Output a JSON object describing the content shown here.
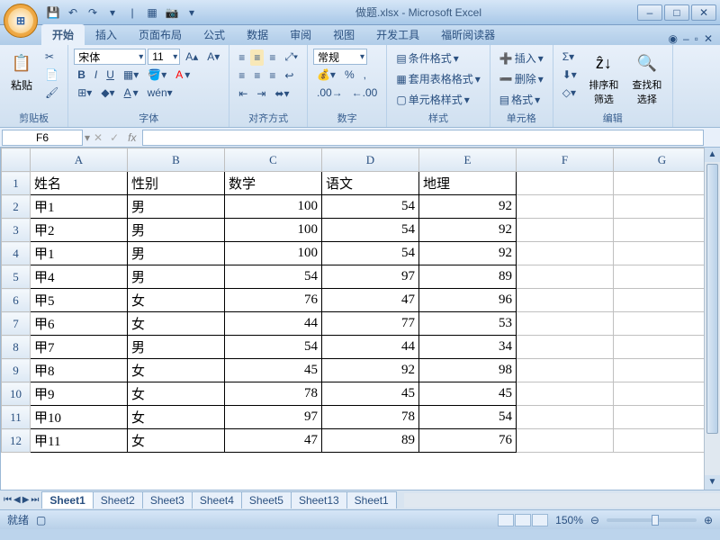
{
  "title": "做题.xlsx - Microsoft Excel",
  "qat": {
    "save": "💾",
    "undo": "↶",
    "redo": "↷"
  },
  "tabs": [
    "开始",
    "插入",
    "页面布局",
    "公式",
    "数据",
    "审阅",
    "视图",
    "开发工具",
    "福昕阅读器"
  ],
  "active_tab": 0,
  "ribbon": {
    "clipboard": {
      "label": "剪贴板",
      "paste": "粘贴",
      "cut": "✂",
      "copy": "📄",
      "brush": "🖌"
    },
    "font": {
      "label": "字体",
      "name": "宋体",
      "size": "11",
      "bold": "B",
      "italic": "I",
      "underline": "U"
    },
    "align": {
      "label": "对齐方式"
    },
    "number": {
      "label": "数字",
      "format": "常规",
      "percent": "%",
      "comma": ","
    },
    "styles": {
      "label": "样式",
      "cond": "条件格式",
      "table": "套用表格格式",
      "cell": "单元格样式"
    },
    "cells": {
      "label": "单元格",
      "insert": "插入",
      "delete": "删除",
      "format": "格式"
    },
    "editing": {
      "label": "编辑",
      "sort": "排序和筛选",
      "find": "查找和选择"
    }
  },
  "namebox": "F6",
  "formula": "",
  "columns": [
    "A",
    "B",
    "C",
    "D",
    "E",
    "F",
    "G"
  ],
  "headers": [
    "姓名",
    "性别",
    "数学",
    "语文",
    "地理"
  ],
  "rows": [
    {
      "n": 1
    },
    {
      "n": 2,
      "d": [
        "甲1",
        "男",
        "100",
        "54",
        "92"
      ]
    },
    {
      "n": 3,
      "d": [
        "甲2",
        "男",
        "100",
        "54",
        "92"
      ]
    },
    {
      "n": 4,
      "d": [
        "甲1",
        "男",
        "100",
        "54",
        "92"
      ]
    },
    {
      "n": 5,
      "d": [
        "甲4",
        "男",
        "54",
        "97",
        "89"
      ]
    },
    {
      "n": 6,
      "d": [
        "甲5",
        "女",
        "76",
        "47",
        "96"
      ]
    },
    {
      "n": 7,
      "d": [
        "甲6",
        "女",
        "44",
        "77",
        "53"
      ]
    },
    {
      "n": 8,
      "d": [
        "甲7",
        "男",
        "54",
        "44",
        "34"
      ]
    },
    {
      "n": 9,
      "d": [
        "甲8",
        "女",
        "45",
        "92",
        "98"
      ]
    },
    {
      "n": 10,
      "d": [
        "甲9",
        "女",
        "78",
        "45",
        "45"
      ]
    },
    {
      "n": 11,
      "d": [
        "甲10",
        "女",
        "97",
        "78",
        "54"
      ]
    },
    {
      "n": 12,
      "d": [
        "甲11",
        "女",
        "47",
        "89",
        "76"
      ]
    }
  ],
  "sheets": [
    "Sheet1",
    "Sheet2",
    "Sheet3",
    "Sheet4",
    "Sheet5",
    "Sheet13",
    "Sheet1"
  ],
  "active_sheet": 0,
  "status": "就绪",
  "zoom": "150%"
}
